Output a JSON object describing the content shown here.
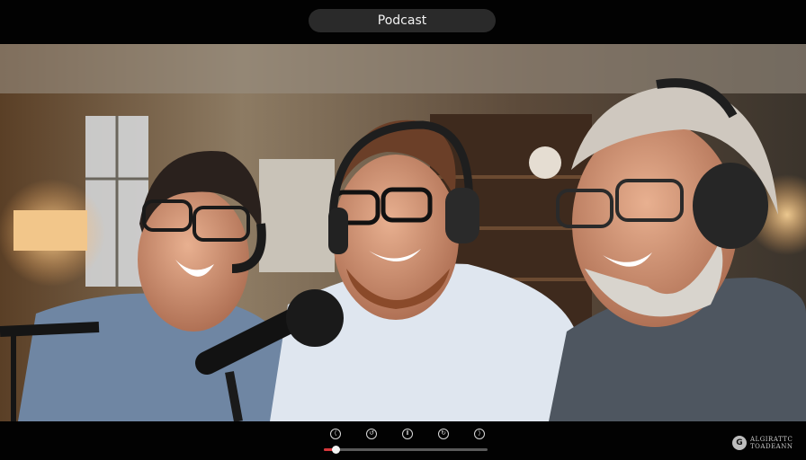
{
  "app": {
    "title": "Podcast"
  },
  "player": {
    "controls": [
      {
        "name": "previous",
        "glyph": "⟨"
      },
      {
        "name": "rewind",
        "glyph": "↺"
      },
      {
        "name": "play-pause",
        "glyph": "Ⅱ"
      },
      {
        "name": "forward",
        "glyph": "↻"
      },
      {
        "name": "next",
        "glyph": "⟩"
      }
    ],
    "progress_fraction": 0.07
  },
  "brand": {
    "line1": "ALGIRATTC",
    "line2": "TOADEANN",
    "icon": "G"
  },
  "colors": {
    "accent": "#d8373b",
    "bar": "#020202",
    "pill": "#2a2a2a"
  }
}
